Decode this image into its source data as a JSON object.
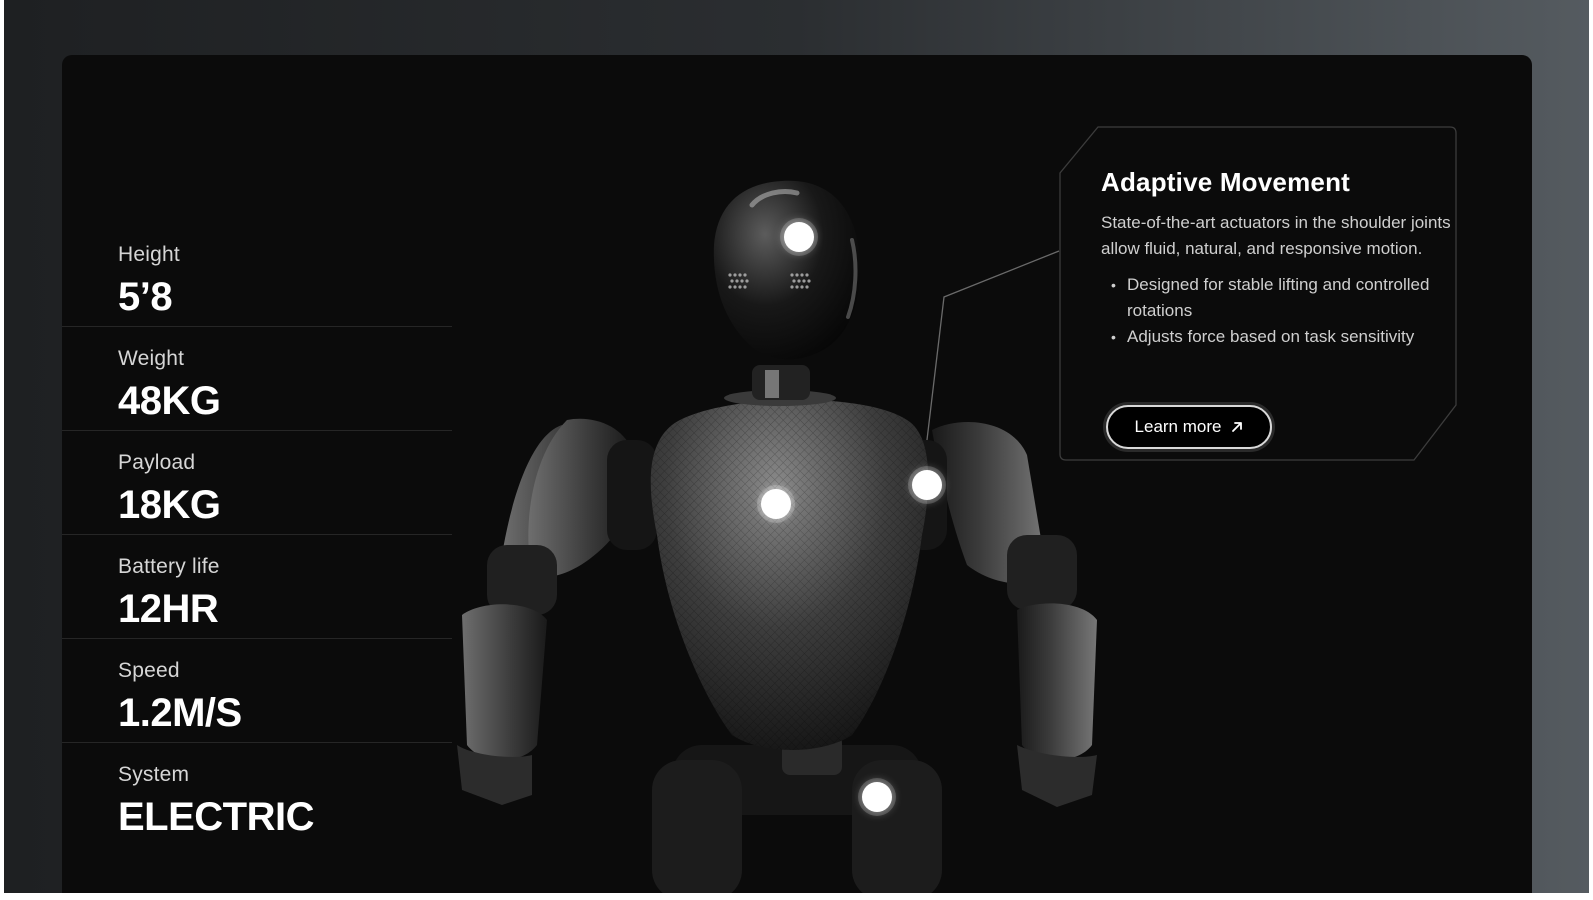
{
  "specs": [
    {
      "label": "Height",
      "value": "5’8"
    },
    {
      "label": "Weight",
      "value": "48KG"
    },
    {
      "label": "Payload",
      "value": "18KG"
    },
    {
      "label": "Battery life",
      "value": "12HR"
    },
    {
      "label": "Speed",
      "value": "1.2M/S"
    },
    {
      "label": "System",
      "value": "ELECTRIC"
    }
  ],
  "callout": {
    "title": "Adaptive Movement",
    "description": "State-of-the-art actuators in the shoulder joints allow fluid, natural, and responsive motion.",
    "bullets": [
      "Designed for stable lifting and controlled rotations",
      "Adjusts force based on task sensitivity"
    ],
    "button_label": "Learn more",
    "button_icon": "arrow-up-right-icon"
  },
  "hotspots": [
    "head-hotspot",
    "chest-hotspot",
    "shoulder-hotspot",
    "hip-hotspot"
  ],
  "colors": {
    "panel_bg": "#0b0b0b",
    "text_primary": "#ffffff",
    "text_secondary": "#d6d6d6",
    "accent_hotspot": "#ffffff"
  }
}
